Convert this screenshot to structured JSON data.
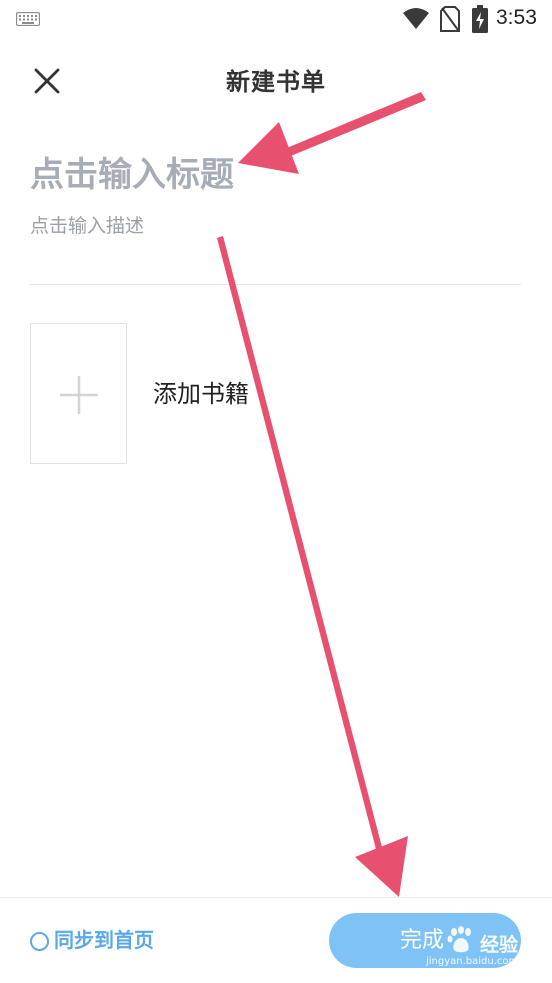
{
  "status_bar": {
    "time": "3:53",
    "icons": [
      "keyboard-icon",
      "wifi-icon",
      "no-sim-icon",
      "battery-charging-icon"
    ]
  },
  "header": {
    "close_icon": "close-icon",
    "title": "新建书单"
  },
  "form": {
    "title_placeholder": "点击输入标题",
    "description_placeholder": "点击输入描述"
  },
  "add_book": {
    "icon": "plus-icon",
    "label": "添加书籍"
  },
  "bottom_bar": {
    "sync_label": "同步到首页",
    "sync_checked": false,
    "done_label": "完成"
  },
  "watermark": {
    "word": "经验",
    "url": "jingyan.baidu.com"
  },
  "colors": {
    "accent_blue": "#5aa7ea",
    "done_button": "#7fc3f6",
    "annotation_arrow": "#e8506f",
    "placeholder_gray": "#a7adb7"
  }
}
